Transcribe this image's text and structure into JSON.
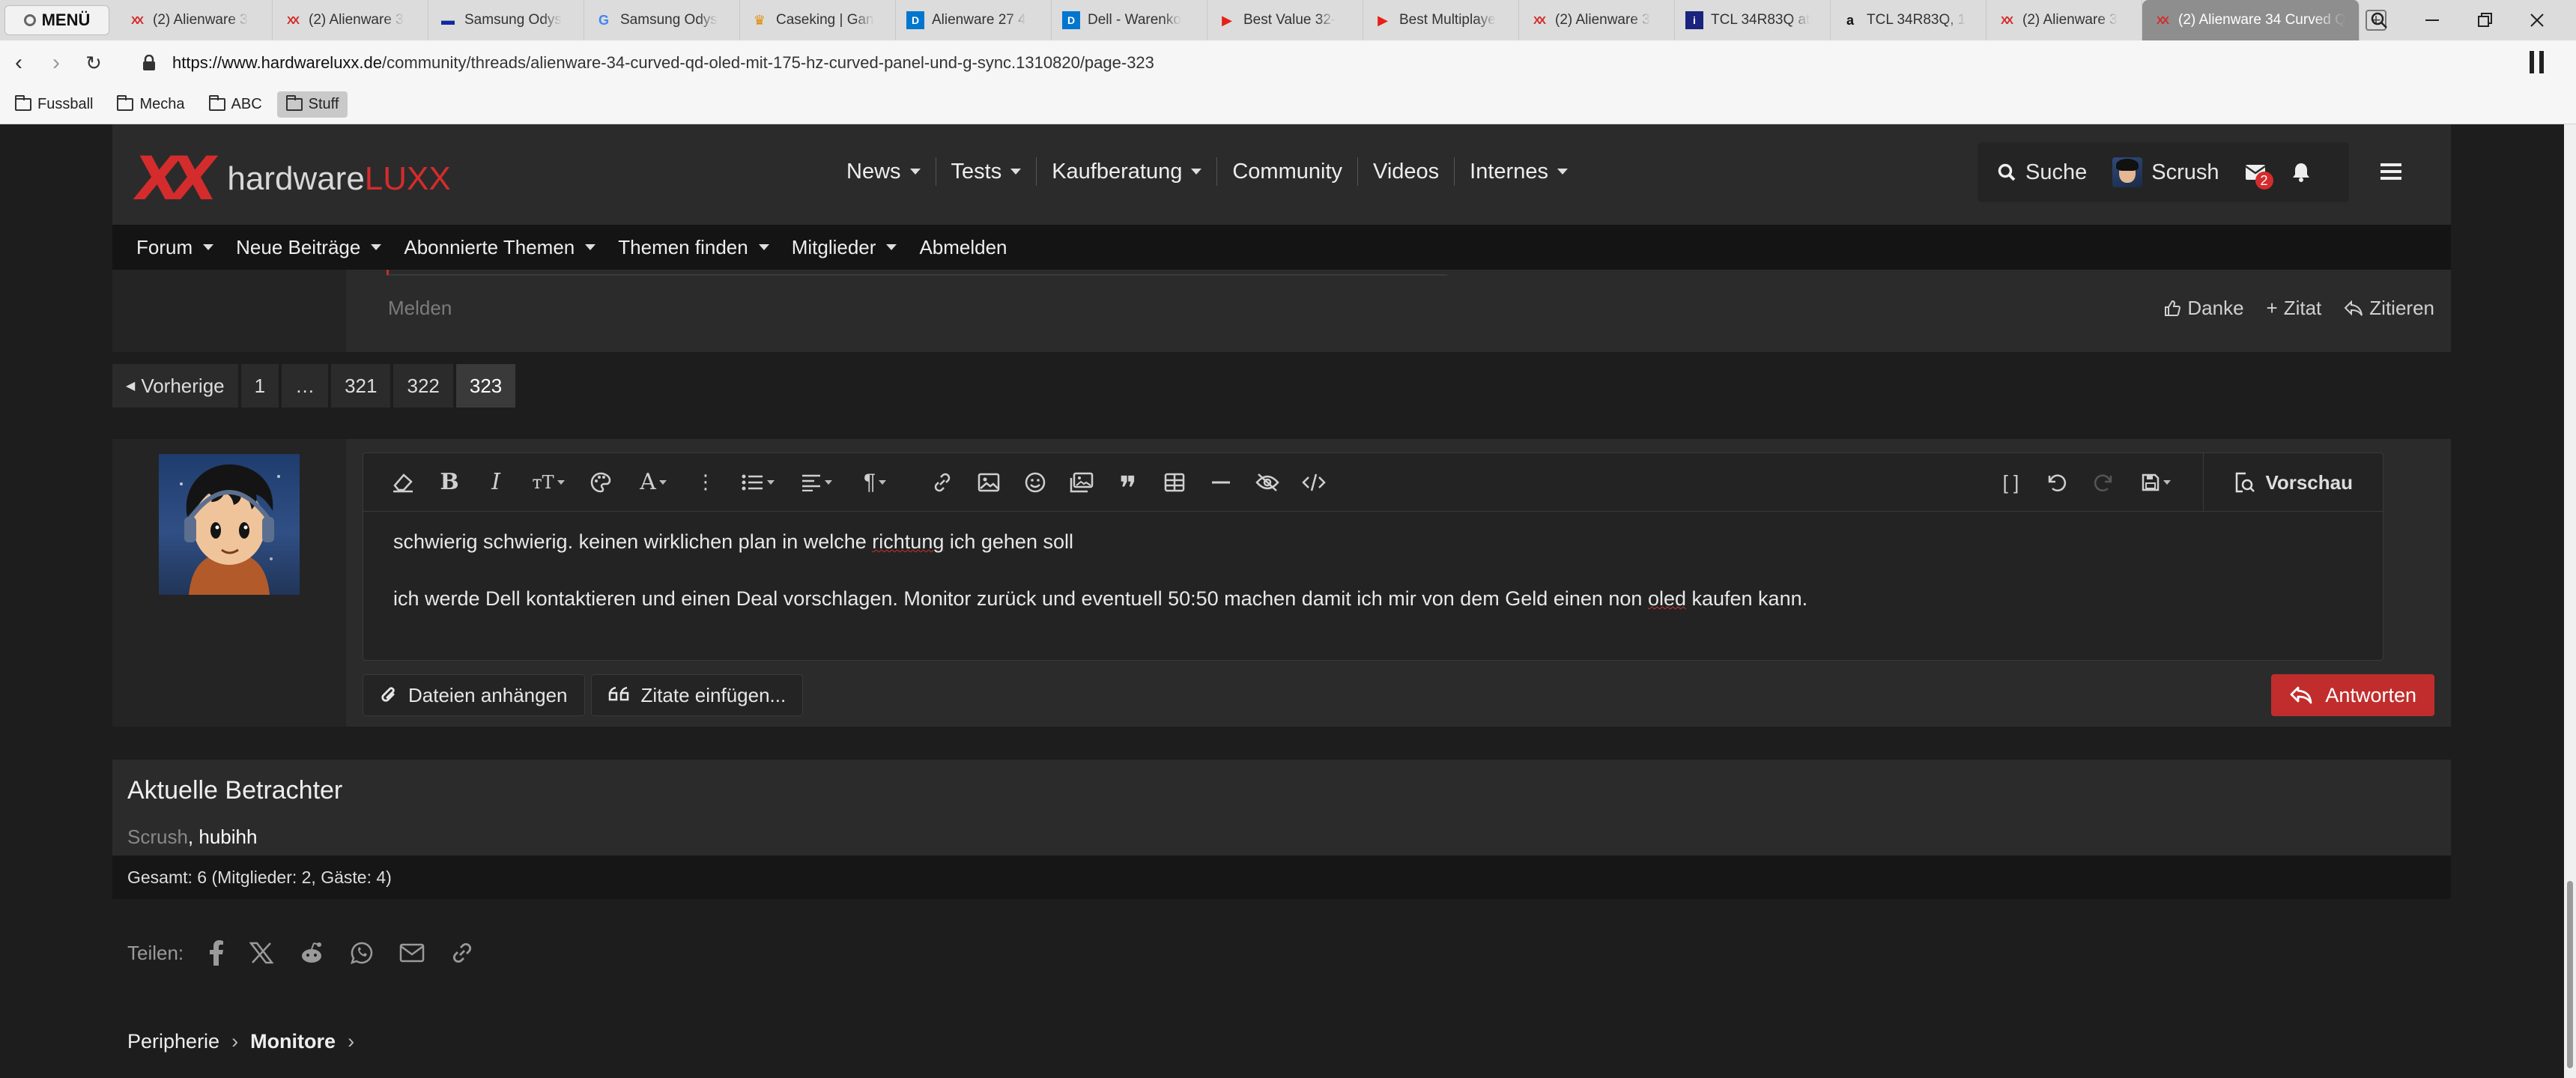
{
  "browser": {
    "menu_label": "MENÜ",
    "tabs": [
      {
        "title": "(2) Alienware 3",
        "icon": "hardwareluxx-icon"
      },
      {
        "title": "(2) Alienware 3",
        "icon": "hardwareluxx-icon"
      },
      {
        "title": "Samsung Odys",
        "icon": "samsung-icon"
      },
      {
        "title": "Samsung Odys",
        "icon": "google-icon"
      },
      {
        "title": "Caseking | Gan",
        "icon": "caseking-icon"
      },
      {
        "title": "Alienware 27 4",
        "icon": "dell-icon"
      },
      {
        "title": "Dell - Warenko",
        "icon": "dell-icon"
      },
      {
        "title": "Best Value 32-",
        "icon": "youtube-icon"
      },
      {
        "title": "Best Multiplaye",
        "icon": "youtube-icon"
      },
      {
        "title": "(2) Alienware 3",
        "icon": "hardwareluxx-icon"
      },
      {
        "title": "TCL 34R83Q at",
        "icon": "info-icon"
      },
      {
        "title": "TCL 34R83Q, 1",
        "icon": "amazon-icon"
      },
      {
        "title": "(2) Alienware 3",
        "icon": "hardwareluxx-icon"
      },
      {
        "title": "(2) Alienware 34 Curved Q",
        "icon": "hardwareluxx-icon",
        "active": true
      }
    ],
    "url_host": "https://www.hardwareluxx.de",
    "url_path": "/community/threads/alienware-34-curved-qd-oled-mit-175-hz-curved-panel-und-g-sync.1310820/page-323",
    "bookmarks": [
      "Fussball",
      "Mecha",
      "ABC",
      "Stuff"
    ]
  },
  "header": {
    "logo_mark": "XX",
    "logo_hardware": "hardware",
    "logo_luxx": "LUXX",
    "nav": [
      {
        "label": "News",
        "dropdown": true
      },
      {
        "label": "Tests",
        "dropdown": true
      },
      {
        "label": "Kaufberatung",
        "dropdown": true
      },
      {
        "label": "Community",
        "dropdown": false
      },
      {
        "label": "Videos",
        "dropdown": false
      },
      {
        "label": "Internes",
        "dropdown": true
      }
    ],
    "search_label": "Suche",
    "username": "Scrush",
    "inbox_count": "2"
  },
  "subnav": [
    {
      "label": "Forum",
      "dropdown": true
    },
    {
      "label": "Neue Beiträge",
      "dropdown": true
    },
    {
      "label": "Abonnierte Themen",
      "dropdown": true
    },
    {
      "label": "Themen finden",
      "dropdown": true
    },
    {
      "label": "Mitglieder",
      "dropdown": true
    },
    {
      "label": "Abmelden",
      "dropdown": false
    }
  ],
  "post": {
    "report_label": "Melden",
    "like_label": "Danke",
    "quote_plus_label": "Zitat",
    "reply_quote_label": "Zitieren"
  },
  "pagination": {
    "prev_label": "Vorherige",
    "pages": [
      "1",
      "…",
      "321",
      "322",
      "323"
    ],
    "current": "323"
  },
  "editor": {
    "preview_label": "Vorschau",
    "line1": "schwierig schwierig. keinen wirklichen plan in welche richtung ich gehen soll",
    "line2": "ich werde Dell kontaktieren und einen Deal vorschlagen. Monitor zurück und eventuell 50:50 machen damit ich mir von dem Geld einen non oled kaufen kann.",
    "attach_label": "Dateien anhängen",
    "insert_quotes_label": "Zitate einfügen...",
    "submit_label": "Antworten"
  },
  "viewers": {
    "title": "Aktuelle Betrachter",
    "self": "Scrush",
    "others": ", hubihh",
    "total": "Gesamt: 6 (Mitglieder: 2, Gäste: 4)"
  },
  "share": {
    "label": "Teilen:",
    "icons": [
      "facebook-icon",
      "x-icon",
      "reddit-icon",
      "whatsapp-icon",
      "email-icon",
      "link-icon"
    ]
  },
  "breadcrumb": [
    "Peripherie",
    "Monitore"
  ],
  "colors": {
    "accent": "#c12d2d",
    "page_bg": "#1d1d1d",
    "panel_bg": "#2b2b2b"
  }
}
